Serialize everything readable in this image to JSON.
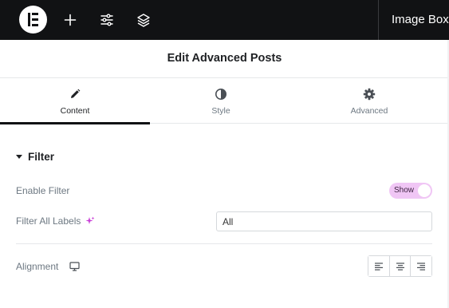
{
  "topbar": {
    "logo_icon": "elementor-logo-icon",
    "add_icon": "plus-icon",
    "settings_icon": "sliders-icon",
    "structure_icon": "layers-icon",
    "title": "Image Box"
  },
  "panel": {
    "title": "Edit Advanced Posts"
  },
  "tabs": [
    {
      "label": "Content",
      "icon": "pencil-icon",
      "active": true
    },
    {
      "label": "Style",
      "icon": "contrast-icon",
      "active": false
    },
    {
      "label": "Advanced",
      "icon": "gear-icon",
      "active": false
    }
  ],
  "section": {
    "title": "Filter",
    "expanded": true
  },
  "controls": {
    "enable_filter": {
      "label": "Enable Filter",
      "toggle_text": "Show",
      "value": true
    },
    "filter_all_labels": {
      "label": "Filter All Labels",
      "value": "All",
      "ai_icon": "sparkle-icon"
    },
    "alignment": {
      "label": "Alignment",
      "device_icon": "desktop-icon",
      "options": [
        "left",
        "center",
        "right"
      ]
    }
  },
  "colors": {
    "topbar_bg": "#111214",
    "toggle_on": "#f0c6f5",
    "ai_accent": "#c93fd7"
  }
}
